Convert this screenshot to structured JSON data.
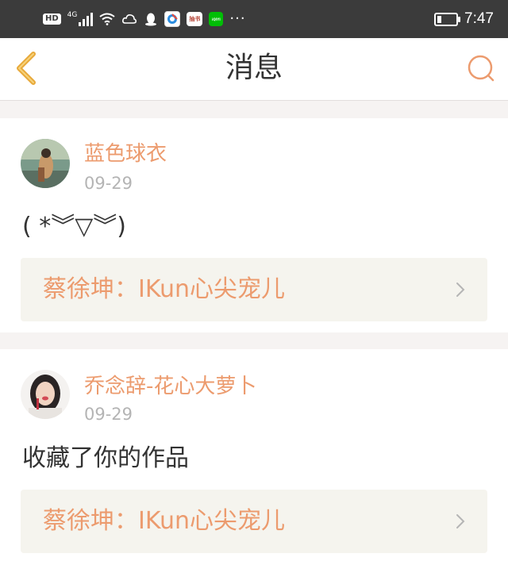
{
  "status_bar": {
    "hd_label": "HD",
    "network_label": "4G",
    "app_badge_book": "抽书",
    "app_badge_iqiyi": "iQIYI",
    "more": "···",
    "time": "7:47",
    "battery_level": 0.3
  },
  "header": {
    "title": "消息"
  },
  "colors": {
    "accent": "#ec9b6e",
    "back_arrow": "#e8a93a",
    "work_bg": "#f5f4ee"
  },
  "messages": [
    {
      "user": "蓝色球衣",
      "date": "09-29",
      "text": "( *︾▽︾)",
      "work_title": "蔡徐坤：IKun心尖宠儿"
    },
    {
      "user": "乔念辞-花心大萝卜",
      "date": "09-29",
      "text": "收藏了你的作品",
      "work_title": "蔡徐坤：IKun心尖宠儿"
    }
  ]
}
